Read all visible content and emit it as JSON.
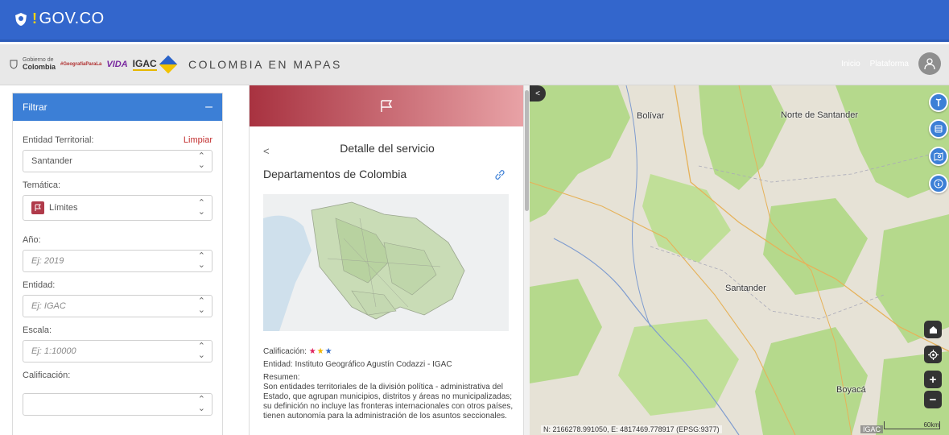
{
  "gov_bar": {
    "logo_text": "GOV.CO",
    "bang": "!"
  },
  "header": {
    "logos": {
      "gobierno_small": "Gobierno de",
      "gobierno_big": "Colombia",
      "geografia": "#GeografíaParaLa",
      "vida": "VIDA",
      "igac": "IGAC"
    },
    "title": "COLOMBIA EN MAPAS",
    "nav": [
      "Inicio",
      "Plataforma"
    ],
    "user_icon": "user-icon"
  },
  "filter": {
    "title": "Filtrar",
    "collapse": "–",
    "entidad_territorial_label": "Entidad Territorial:",
    "clear_label": "Limpiar",
    "entidad_territorial_value": "Santander",
    "tematica_label": "Temática:",
    "tematica_value": "Límites",
    "anio_label": "Año:",
    "anio_placeholder": "Ej: 2019",
    "entidad_label": "Entidad:",
    "entidad_placeholder": "Ej: IGAC",
    "escala_label": "Escala:",
    "escala_placeholder": "Ej: 1:10000",
    "calificacion_label": "Calificación:",
    "calificacion_value": ""
  },
  "detail": {
    "back": "<",
    "title": "Detalle del servicio",
    "service_name": "Departamentos de Colombia",
    "calificacion_label": "Calificación:",
    "stars": 3,
    "entidad": "Entidad: Instituto Geográfico Agustín Codazzi - IGAC",
    "resumen_label": "Resumen:",
    "resumen_text": "Son entidades territoriales de la división política - administrativa del Estado, que agrupan municipios, distritos y áreas no municipalizadas; su definición no incluye las fronteras internacionales con otros países, tienen autonomía para la administración de los asuntos seccionales."
  },
  "map": {
    "labels": [
      "Bolívar",
      "Norte de Santander",
      "Santander",
      "Boyacá"
    ],
    "collapse": "<",
    "coords": "N: 2166278.991050, E: 4817469.778917 (EPSG:9377)",
    "attribution": "IGAC",
    "scale": "60km",
    "tools": [
      "wrench-icon",
      "layers-icon",
      "map-search-icon",
      "info-icon"
    ],
    "controls": [
      "home-icon",
      "locate-icon",
      "zoom-in-icon",
      "zoom-out-icon"
    ],
    "zoom_in": "+",
    "zoom_out": "−"
  },
  "colors": {
    "gov_blue": "#3366cc",
    "filter_blue": "#3c7fd6",
    "banner_red": "#a83240",
    "map_green": "#b5d98c"
  }
}
